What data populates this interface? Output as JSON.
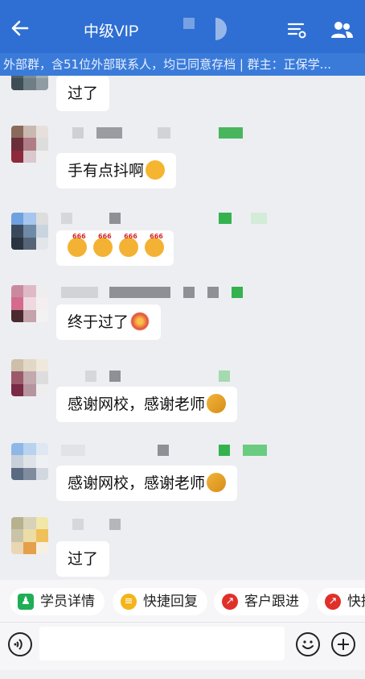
{
  "header": {
    "title": "中级VIP",
    "notice": "外部群，含51位外部联系人，均已同意存档 | 群主：正保学...",
    "colors": {
      "bar": "#2f6fd3",
      "notice_bg": "#3a7bd9"
    }
  },
  "messages": [
    {
      "text": "过了",
      "emoji": ""
    },
    {
      "text": "手有点抖啊",
      "emoji": "sweat-laugh"
    },
    {
      "text": "",
      "emoji": "666x4"
    },
    {
      "text": "终于过了",
      "emoji": "fireworks"
    },
    {
      "text": "感谢网校，感谢老师",
      "emoji": "applause-hand"
    },
    {
      "text": "感谢网校，感谢老师",
      "emoji": "applause-hand"
    },
    {
      "text": "过了",
      "emoji": ""
    }
  ],
  "emoji_text": {
    "six": "666"
  },
  "shortcuts": [
    {
      "label": "学员详情",
      "icon": "person-icon"
    },
    {
      "label": "快捷回复",
      "icon": "quick-reply-icon"
    },
    {
      "label": "客户跟进",
      "icon": "follow-up-icon"
    },
    {
      "label": "快捷",
      "icon": "follow-up-icon"
    }
  ],
  "input": {
    "placeholder": "",
    "value": ""
  }
}
